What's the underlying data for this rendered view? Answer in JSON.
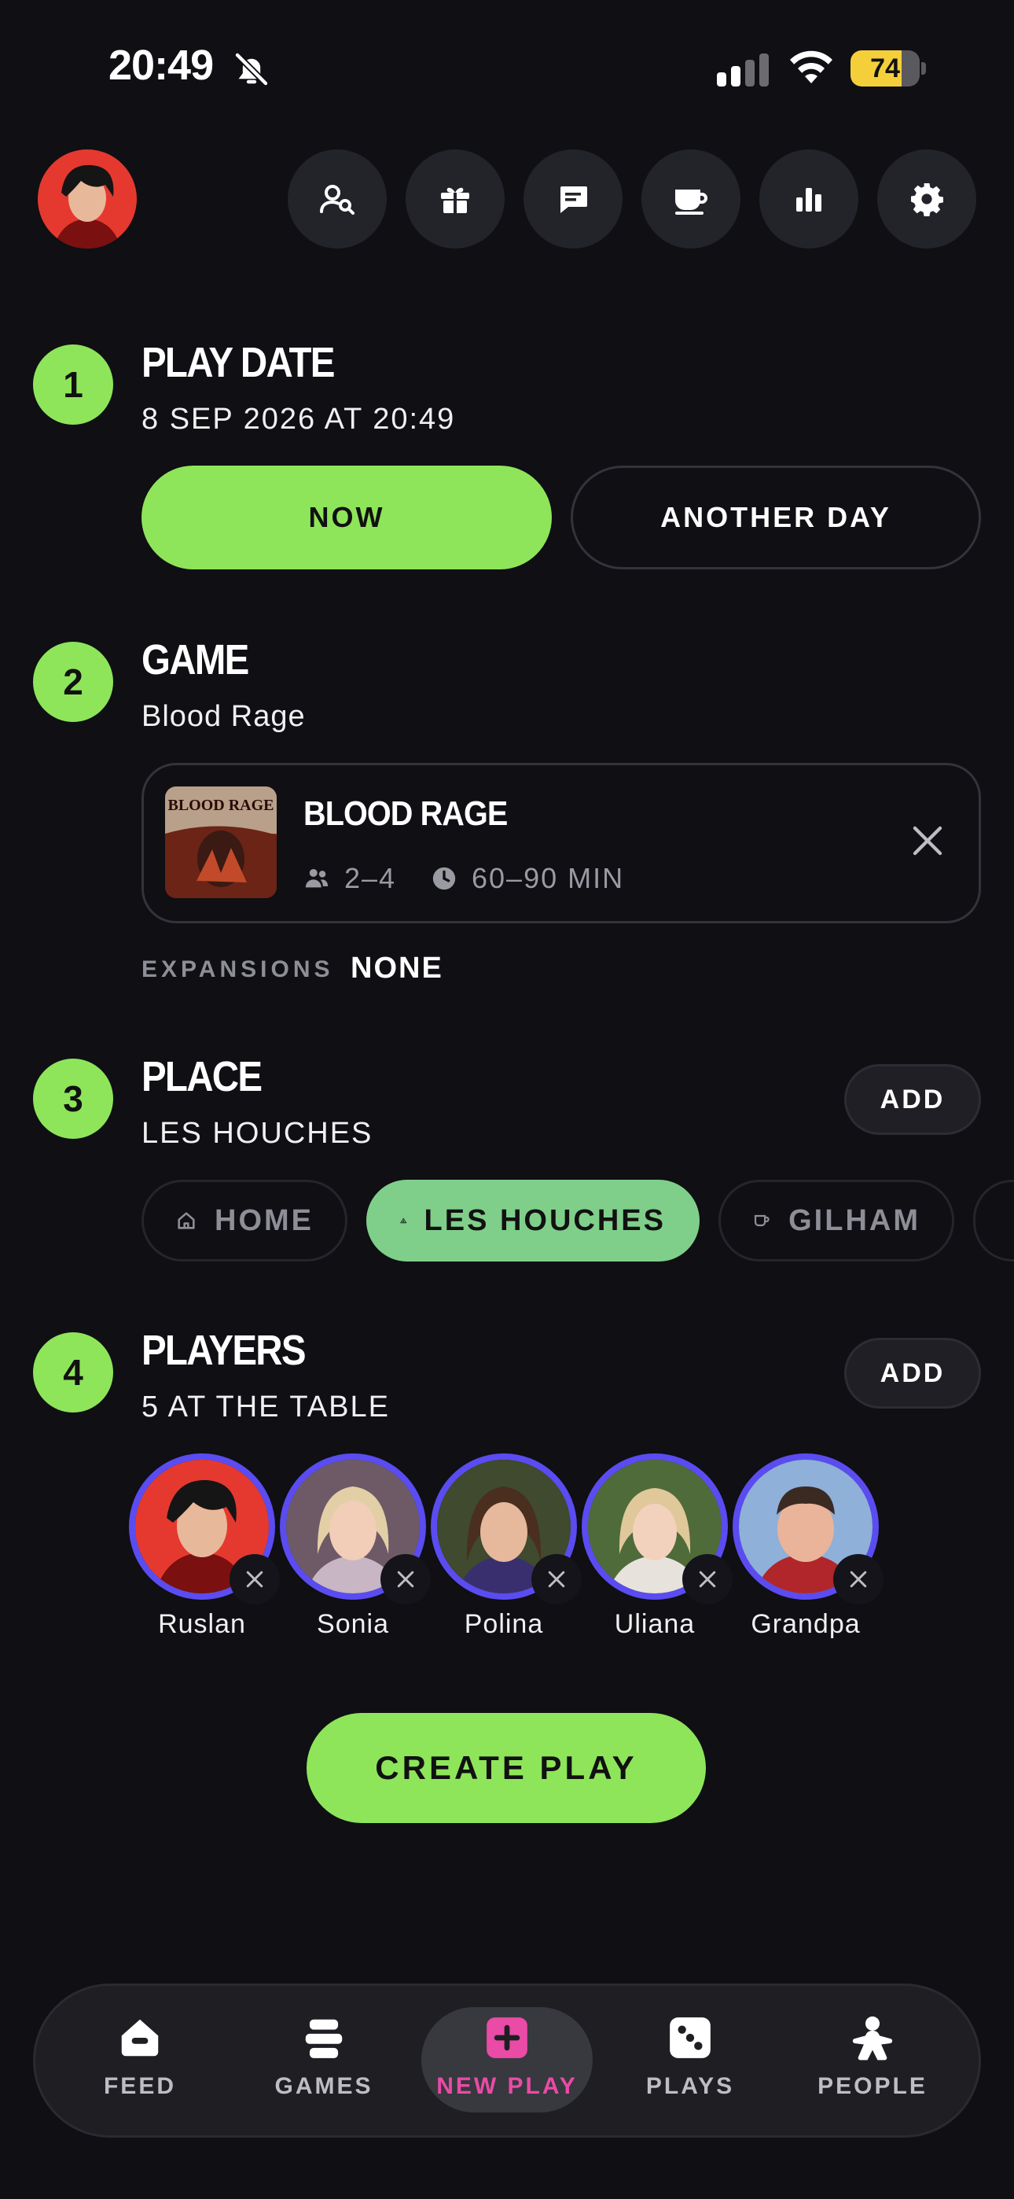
{
  "status_bar": {
    "time": "20:49",
    "battery": "74",
    "battery_level": 0.74
  },
  "header": {
    "avatar_name": "Ruslan",
    "actions": [
      {
        "icon": "user-search-icon"
      },
      {
        "icon": "gift-icon"
      },
      {
        "icon": "chat-icon"
      },
      {
        "icon": "coffee-icon"
      },
      {
        "icon": "stats-icon"
      },
      {
        "icon": "gear-icon"
      }
    ]
  },
  "play_date": {
    "step": "1",
    "title": "PLAY DATE",
    "value": "8 SEP 2026 AT 20:49",
    "now_label": "NOW",
    "another_day_label": "ANOTHER DAY"
  },
  "game": {
    "step": "2",
    "title": "GAME",
    "value": "Blood Rage",
    "card": {
      "name": "BLOOD RAGE",
      "players": "2–4",
      "duration": "60–90 MIN",
      "cover_text": "BLOOD RAGE"
    },
    "expansions_label": "EXPANSIONS",
    "expansions_value": "NONE"
  },
  "place": {
    "step": "3",
    "title": "PLACE",
    "value": "LES HOUCHES",
    "add_label": "ADD",
    "chips": [
      {
        "label": "HOME",
        "icon": "home-icon",
        "active": false
      },
      {
        "label": "LES HOUCHES",
        "icon": "mountain-icon",
        "active": true
      },
      {
        "label": "GILHAM",
        "icon": "cup-icon",
        "active": false
      }
    ]
  },
  "players": {
    "step": "4",
    "title": "PLAYERS",
    "value": "5 AT THE TABLE",
    "add_label": "ADD",
    "list": [
      {
        "name": "Ruslan"
      },
      {
        "name": "Sonia"
      },
      {
        "name": "Polina"
      },
      {
        "name": "Uliana"
      },
      {
        "name": "Grandpa"
      }
    ]
  },
  "create_label": "CREATE PLAY",
  "tabs": [
    {
      "label": "FEED",
      "icon": "home-icon"
    },
    {
      "label": "GAMES",
      "icon": "stack-icon"
    },
    {
      "label": "NEW PLAY",
      "icon": "plus-square-icon",
      "active": true
    },
    {
      "label": "PLAYS",
      "icon": "dice-icon"
    },
    {
      "label": "PEOPLE",
      "icon": "meeple-icon"
    }
  ],
  "colors": {
    "accent_green": "#8ee55a",
    "place_active": "#7fcf8a",
    "player_ring": "#5a4cf0",
    "tab_active": "#e94ba6",
    "background": "#0f0f14"
  }
}
